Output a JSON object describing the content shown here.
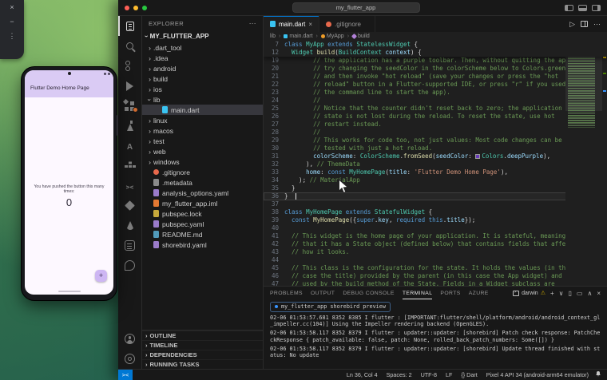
{
  "colors": {
    "vscode_accent": "#0078d4",
    "comment_green": "#6a9955",
    "deep_purple_swatch": "#673ab7",
    "phone_appbar": "#dacbf4",
    "phone_body": "#fdf8ff",
    "phone_fab": "#cdb6f3"
  },
  "desktop": {
    "emulator_toolbar": {
      "icons": [
        "×",
        "−",
        "⋮"
      ]
    }
  },
  "phone": {
    "appbar_title": "Flutter Demo Home Page",
    "counter_label": "You have pushed the button this many times:",
    "counter_value": "0",
    "fab_icon": "+"
  },
  "vscode": {
    "titlebar": {
      "title": "my_flutter_app"
    },
    "activitybar": {
      "top": [
        {
          "name": "explorer",
          "cls": "i-files active"
        },
        {
          "name": "search",
          "cls": "i-search"
        },
        {
          "name": "source-control",
          "cls": "i-scm"
        },
        {
          "name": "run-and-debug",
          "cls": "i-debug"
        },
        {
          "name": "extensions",
          "cls": "i-ext dot"
        },
        {
          "name": "testing",
          "cls": "i-flask"
        },
        {
          "name": "azure",
          "cls": "i-azure"
        },
        {
          "name": "docker",
          "cls": "i-docker"
        },
        {
          "name": "remote-explorer",
          "cls": "i-remote"
        },
        {
          "name": "flutter",
          "cls": "i-flutter"
        },
        {
          "name": "firebase",
          "cls": "i-fire"
        },
        {
          "name": "todo",
          "cls": "i-todo"
        },
        {
          "name": "chat",
          "cls": "i-chat"
        }
      ],
      "bottom": [
        {
          "name": "account",
          "cls": "i-account"
        },
        {
          "name": "settings",
          "cls": "i-gear"
        }
      ]
    },
    "explorer": {
      "header": "EXPLORER",
      "more": "⋯",
      "project": "MY_FLUTTER_APP",
      "tree": [
        {
          "label": ".dart_tool",
          "cls": "folder"
        },
        {
          "label": ".idea",
          "cls": "folder"
        },
        {
          "label": "android",
          "cls": "folder"
        },
        {
          "label": "build",
          "cls": "folder"
        },
        {
          "label": "ios",
          "cls": "folder"
        },
        {
          "label": "lib",
          "cls": "folder expanded"
        },
        {
          "label": "main.dart",
          "cls": "file dart indent active"
        },
        {
          "label": "linux",
          "cls": "folder"
        },
        {
          "label": "macos",
          "cls": "folder"
        },
        {
          "label": "test",
          "cls": "folder"
        },
        {
          "label": "web",
          "cls": "folder"
        },
        {
          "label": "windows",
          "cls": "folder"
        },
        {
          "label": ".gitignore",
          "cls": "file git"
        },
        {
          "label": ".metadata",
          "cls": "file meta"
        },
        {
          "label": "analysis_options.yaml",
          "cls": "file yaml"
        },
        {
          "label": "my_flutter_app.iml",
          "cls": "file xml"
        },
        {
          "label": "pubspec.lock",
          "cls": "file lock"
        },
        {
          "label": "pubspec.yaml",
          "cls": "file yaml"
        },
        {
          "label": "README.md",
          "cls": "file md"
        },
        {
          "label": "shorebird.yaml",
          "cls": "file yaml"
        }
      ],
      "bottom_sections": [
        {
          "label": "OUTLINE"
        },
        {
          "label": "TIMELINE"
        },
        {
          "label": "DEPENDENCIES"
        },
        {
          "label": "RUNNING TASKS"
        }
      ]
    },
    "editor": {
      "tabs": [
        {
          "label": "main.dart",
          "cls": "active dart",
          "close": "×"
        },
        {
          "label": ".gitignore",
          "cls": "git",
          "close": "×"
        }
      ],
      "run_icon": "▷",
      "more_icon": "⋯",
      "breadcrumb": [
        {
          "label": "lib",
          "cls": ""
        },
        {
          "label": "main.dart",
          "cls": "dart"
        },
        {
          "label": "MyApp",
          "cls": "sym-class"
        },
        {
          "label": "build",
          "cls": "sym-method"
        }
      ],
      "sticky": [
        {
          "n": "7",
          "cls": "",
          "seg": [
            {
              "c": "kw",
              "t": "class "
            },
            {
              "c": "type",
              "t": "MyApp"
            },
            {
              "c": "kw",
              "t": " extends "
            },
            {
              "c": "type",
              "t": "StatelessWidget"
            },
            {
              "c": "fg",
              "t": " {"
            }
          ]
        },
        {
          "n": "12",
          "cls": "",
          "seg": [
            {
              "c": "fg",
              "t": "  "
            },
            {
              "c": "type",
              "t": "Widget"
            },
            {
              "c": "fg",
              "t": " "
            },
            {
              "c": "fn",
              "t": "build"
            },
            {
              "c": "fg",
              "t": "("
            },
            {
              "c": "type",
              "t": "BuildContext"
            },
            {
              "c": "fg",
              "t": " "
            },
            {
              "c": "prop",
              "t": "context"
            },
            {
              "c": "fg",
              "t": ") {"
            }
          ]
        }
      ],
      "lines": [
        {
          "n": "19",
          "cls": "",
          "seg": [
            {
              "c": "cmt",
              "t": "        // the application has a purple toolbar. Then, without quitting the app,"
            }
          ]
        },
        {
          "n": "20",
          "cls": "",
          "seg": [
            {
              "c": "cmt",
              "t": "        // try changing the seedColor in the colorScheme below to Colors.green"
            }
          ]
        },
        {
          "n": "21",
          "cls": "",
          "seg": [
            {
              "c": "cmt",
              "t": "        // and then invoke \"hot reload\" (save your changes or press the \"hot"
            }
          ]
        },
        {
          "n": "22",
          "cls": "",
          "seg": [
            {
              "c": "cmt",
              "t": "        // reload\" button in a Flutter-supported IDE, or press \"r\" if you used"
            }
          ]
        },
        {
          "n": "23",
          "cls": "",
          "seg": [
            {
              "c": "cmt",
              "t": "        // the command line to start the app)."
            }
          ]
        },
        {
          "n": "24",
          "cls": "",
          "seg": [
            {
              "c": "cmt",
              "t": "        //"
            }
          ]
        },
        {
          "n": "25",
          "cls": "",
          "seg": [
            {
              "c": "cmt",
              "t": "        // Notice that the counter didn't reset back to zero; the application"
            }
          ]
        },
        {
          "n": "26",
          "cls": "",
          "seg": [
            {
              "c": "cmt",
              "t": "        // state is not lost during the reload. To reset the state, use hot"
            }
          ]
        },
        {
          "n": "27",
          "cls": "",
          "seg": [
            {
              "c": "cmt",
              "t": "        // restart instead."
            }
          ]
        },
        {
          "n": "28",
          "cls": "",
          "seg": [
            {
              "c": "cmt",
              "t": "        //"
            }
          ]
        },
        {
          "n": "29",
          "cls": "",
          "seg": [
            {
              "c": "cmt",
              "t": "        // This works for code too, not just values: Most code changes can be"
            }
          ]
        },
        {
          "n": "30",
          "cls": "",
          "seg": [
            {
              "c": "cmt",
              "t": "        // tested with just a hot reload."
            }
          ]
        },
        {
          "n": "31",
          "cls": "",
          "seg": [
            {
              "c": "fg",
              "t": "        "
            },
            {
              "c": "prop",
              "t": "colorScheme"
            },
            {
              "c": "fg",
              "t": ": "
            },
            {
              "c": "type",
              "t": "ColorScheme"
            },
            {
              "c": "fg",
              "t": "."
            },
            {
              "c": "fn",
              "t": "fromSeed"
            },
            {
              "c": "fg",
              "t": "("
            },
            {
              "c": "prop",
              "t": "seedColor"
            },
            {
              "c": "fg",
              "t": ": "
            },
            {
              "c": "swatch",
              "t": ""
            },
            {
              "c": "type",
              "t": "Colors"
            },
            {
              "c": "fg",
              "t": "."
            },
            {
              "c": "prop",
              "t": "deepPurple"
            },
            {
              "c": "fg",
              "t": "),"
            }
          ]
        },
        {
          "n": "32",
          "cls": "",
          "seg": [
            {
              "c": "fg",
              "t": "      ), "
            },
            {
              "c": "cmt",
              "t": "// ThemeData"
            }
          ]
        },
        {
          "n": "33",
          "cls": "",
          "seg": [
            {
              "c": "fg",
              "t": "      "
            },
            {
              "c": "prop",
              "t": "home"
            },
            {
              "c": "fg",
              "t": ": "
            },
            {
              "c": "kw",
              "t": "const"
            },
            {
              "c": "fg",
              "t": " "
            },
            {
              "c": "type",
              "t": "MyHomePage"
            },
            {
              "c": "fg",
              "t": "("
            },
            {
              "c": "prop",
              "t": "title"
            },
            {
              "c": "fg",
              "t": ": "
            },
            {
              "c": "str",
              "t": "'Flutter Demo Home Page'"
            },
            {
              "c": "fg",
              "t": "),"
            }
          ]
        },
        {
          "n": "34",
          "cls": "",
          "seg": [
            {
              "c": "fg",
              "t": "    ); "
            },
            {
              "c": "cmt",
              "t": "// MaterialApp"
            }
          ]
        },
        {
          "n": "35",
          "cls": "",
          "seg": [
            {
              "c": "fg",
              "t": "  }"
            }
          ]
        },
        {
          "n": "36",
          "cls": "cur",
          "seg": [
            {
              "c": "fg",
              "t": "}"
            }
          ]
        },
        {
          "n": "37",
          "cls": "",
          "seg": []
        },
        {
          "n": "38",
          "cls": "",
          "seg": [
            {
              "c": "kw",
              "t": "class "
            },
            {
              "c": "type",
              "t": "MyHomePage"
            },
            {
              "c": "kw",
              "t": " extends "
            },
            {
              "c": "type",
              "t": "StatefulWidget"
            },
            {
              "c": "fg",
              "t": " {"
            }
          ]
        },
        {
          "n": "39",
          "cls": "",
          "seg": [
            {
              "c": "fg",
              "t": "  "
            },
            {
              "c": "kw",
              "t": "const"
            },
            {
              "c": "fg",
              "t": " "
            },
            {
              "c": "fn",
              "t": "MyHomePage"
            },
            {
              "c": "fg",
              "t": "({"
            },
            {
              "c": "kw",
              "t": "super"
            },
            {
              "c": "fg",
              "t": "."
            },
            {
              "c": "prop",
              "t": "key"
            },
            {
              "c": "fg",
              "t": ", "
            },
            {
              "c": "kw",
              "t": "required"
            },
            {
              "c": "fg",
              "t": " "
            },
            {
              "c": "kw",
              "t": "this"
            },
            {
              "c": "fg",
              "t": "."
            },
            {
              "c": "prop",
              "t": "title"
            },
            {
              "c": "fg",
              "t": "});"
            }
          ]
        },
        {
          "n": "40",
          "cls": "",
          "seg": []
        },
        {
          "n": "41",
          "cls": "",
          "seg": [
            {
              "c": "cmt",
              "t": "  // This widget is the home page of your application. It is stateful, meaning"
            }
          ]
        },
        {
          "n": "42",
          "cls": "",
          "seg": [
            {
              "c": "cmt",
              "t": "  // that it has a State object (defined below) that contains fields that affect"
            }
          ]
        },
        {
          "n": "43",
          "cls": "",
          "seg": [
            {
              "c": "cmt",
              "t": "  // how it looks."
            }
          ]
        },
        {
          "n": "44",
          "cls": "",
          "seg": []
        },
        {
          "n": "45",
          "cls": "",
          "seg": [
            {
              "c": "cmt",
              "t": "  // This class is the configuration for the state. It holds the values (in this"
            }
          ]
        },
        {
          "n": "46",
          "cls": "",
          "seg": [
            {
              "c": "cmt",
              "t": "  // case the title) provided by the parent (in this case the App widget) and"
            }
          ]
        },
        {
          "n": "47",
          "cls": "",
          "seg": [
            {
              "c": "cmt",
              "t": "  // used by the build method of the State. Fields in a Widget subclass are"
            }
          ]
        }
      ]
    },
    "panel": {
      "tabs": [
        {
          "label": "PROBLEMS",
          "cls": ""
        },
        {
          "label": "OUTPUT",
          "cls": ""
        },
        {
          "label": "DEBUG CONSOLE",
          "cls": ""
        },
        {
          "label": "TERMINAL",
          "cls": "active"
        },
        {
          "label": "PORTS",
          "cls": ""
        },
        {
          "label": "AZURE",
          "cls": ""
        }
      ],
      "shell_label": "darwin",
      "warn_icon": "⚠",
      "action_icons": [
        {
          "glyph": "+",
          "name": "new-terminal-icon"
        },
        {
          "glyph": "∨",
          "name": "terminal-dropdown-icon"
        },
        {
          "glyph": "▯",
          "name": "split-terminal-icon"
        },
        {
          "glyph": "▭",
          "name": "kill-terminal-icon"
        },
        {
          "glyph": "∧",
          "name": "maximize-panel-icon"
        },
        {
          "glyph": "×",
          "name": "close-panel-icon"
        }
      ],
      "command": "my_flutter_app shorebird preview",
      "log": [
        "02-06 01:53:57.681  8352  8385 I flutter : [IMPORTANT:flutter/shell/platform/android/android_context_gl_impeller.cc(104)] Using the Impeller rendering backend (OpenGLES).",
        "02-06 01:53:58.117  8352  8379 I flutter : updater::updater: [shorebird] Patch check response: PatchCheckResponse { patch_available: false, patch: None, rolled_back_patch_numbers: Some([]) }",
        "02-06 01:53:58.117  8352  8379 I flutter : updater::updater: [shorebird] Update thread finished with status: No update"
      ]
    },
    "statusbar": {
      "remote_icon": "><",
      "items": [
        {
          "label": "Ln 36, Col 4"
        },
        {
          "label": "Spaces: 2"
        },
        {
          "label": "UTF-8"
        },
        {
          "label": "LF"
        },
        {
          "label": "{} Dart"
        },
        {
          "label": "Pixel 4 API 34 (android-arm64 emulator)"
        }
      ]
    }
  }
}
